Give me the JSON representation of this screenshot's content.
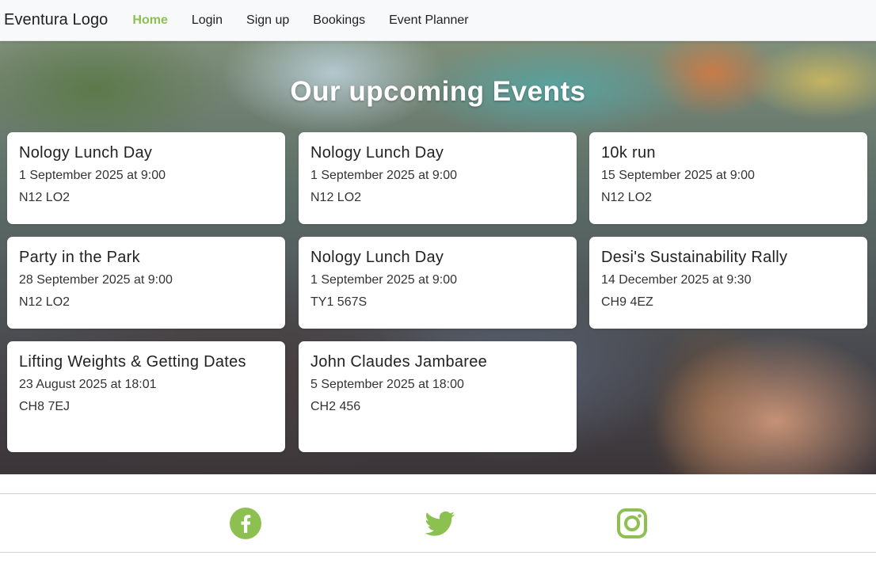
{
  "navbar": {
    "brand": "Eventura Logo",
    "links": [
      {
        "label": "Home",
        "active": true
      },
      {
        "label": "Login",
        "active": false
      },
      {
        "label": "Sign up",
        "active": false
      },
      {
        "label": "Bookings",
        "active": false
      },
      {
        "label": "Event Planner",
        "active": false
      }
    ]
  },
  "hero": {
    "title": "Our upcoming Events"
  },
  "events": [
    {
      "title": "Nology Lunch Day",
      "date": "1 September 2025 at 9:00",
      "postcode": "N12 LO2"
    },
    {
      "title": "Nology Lunch Day",
      "date": "1 September 2025 at 9:00",
      "postcode": "N12 LO2"
    },
    {
      "title": "10k run",
      "date": "15 September 2025 at 9:00",
      "postcode": "N12 LO2"
    },
    {
      "title": "Party in the Park",
      "date": "28 September 2025 at 9:00",
      "postcode": "N12 LO2"
    },
    {
      "title": "Nology Lunch Day",
      "date": "1 September 2025 at 9:00",
      "postcode": "TY1 567S"
    },
    {
      "title": "Desi's Sustainability Rally",
      "date": "14 December 2025 at 9:30",
      "postcode": "CH9 4EZ"
    },
    {
      "title": "Lifting Weights & Getting Dates",
      "date": "23 August 2025 at 18:01",
      "postcode": "CH8 7EJ"
    },
    {
      "title": "John Claudes Jambaree",
      "date": "5 September 2025 at 18:00",
      "postcode": "CH2 456"
    }
  ],
  "footer": {
    "social": [
      {
        "icon": "facebook-icon"
      },
      {
        "icon": "twitter-icon"
      },
      {
        "icon": "instagram-icon"
      }
    ]
  },
  "colors": {
    "accent": "#8cc152",
    "navbar_bg": "#f8f9fa",
    "card_bg": "#ffffff"
  }
}
